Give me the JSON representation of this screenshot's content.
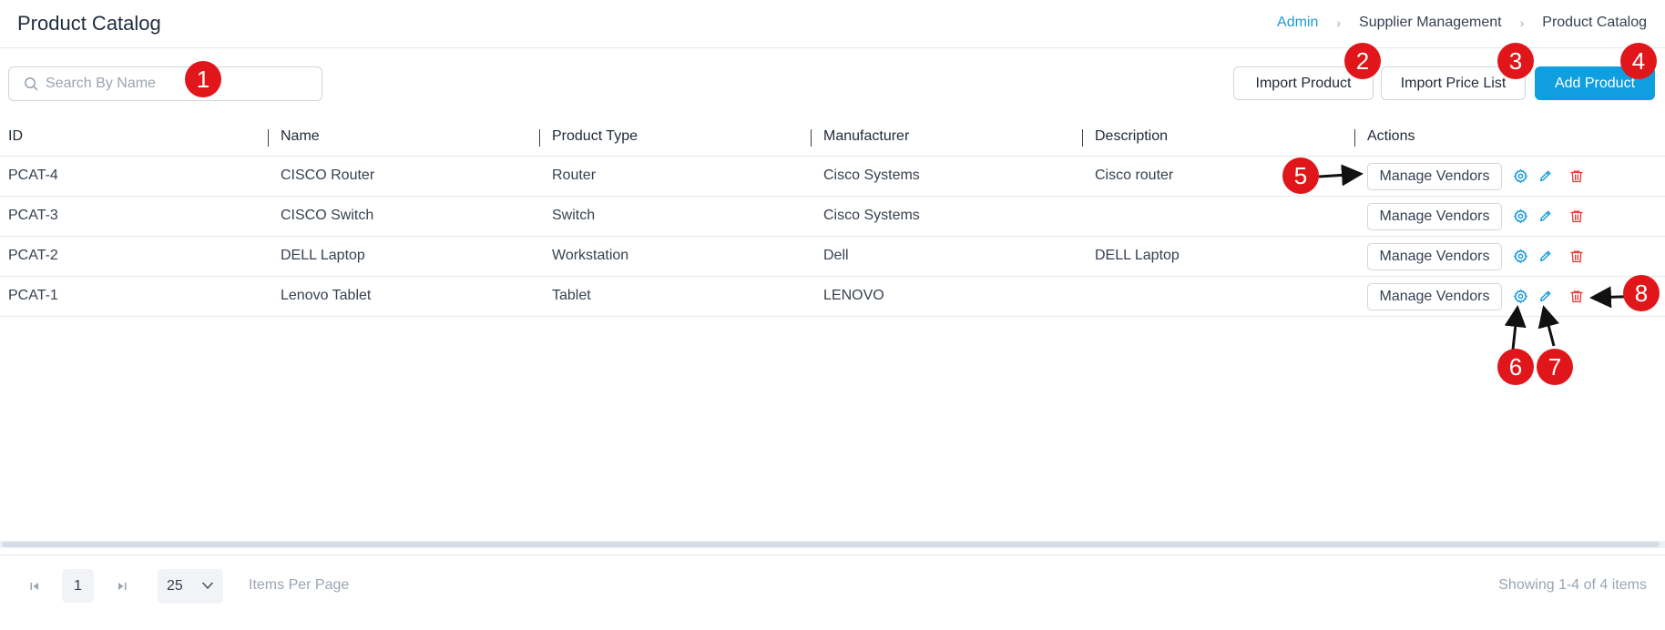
{
  "header": {
    "title": "Product Catalog",
    "breadcrumb": [
      "Admin",
      "Supplier Management",
      "Product Catalog"
    ]
  },
  "toolbar": {
    "search_placeholder": "Search By Name",
    "import_product_label": "Import Product",
    "import_price_list_label": "Import Price List",
    "add_product_label": "Add Product"
  },
  "table": {
    "columns": [
      "ID",
      "Name",
      "Product Type",
      "Manufacturer",
      "Description",
      "Actions"
    ],
    "rows": [
      {
        "id": "PCAT-4",
        "name": "CISCO Router",
        "type": "Router",
        "manufacturer": "Cisco Systems",
        "description": "Cisco router",
        "action_label": "Manage Vendors"
      },
      {
        "id": "PCAT-3",
        "name": "CISCO Switch",
        "type": "Switch",
        "manufacturer": "Cisco Systems",
        "description": "",
        "action_label": "Manage Vendors"
      },
      {
        "id": "PCAT-2",
        "name": "DELL Laptop",
        "type": "Workstation",
        "manufacturer": "Dell",
        "description": "DELL Laptop",
        "action_label": "Manage Vendors"
      },
      {
        "id": "PCAT-1",
        "name": "Lenovo Tablet",
        "type": "Tablet",
        "manufacturer": "LENOVO",
        "description": "",
        "action_label": "Manage Vendors"
      }
    ]
  },
  "pagination": {
    "current_page": "1",
    "per_page": "25",
    "per_page_label": "Items Per Page",
    "showing_text": "Showing 1-4 of 4 items"
  },
  "callouts": [
    "1",
    "2",
    "3",
    "4",
    "5",
    "6",
    "7",
    "8"
  ],
  "colors": {
    "accent": "#0f9ee0",
    "breadcrumb_link": "#1a9bd7",
    "gear_icon": "#1a9bd7",
    "edit_icon": "#1a9bd7",
    "delete_icon": "#e53935",
    "callout": "#e0161b"
  },
  "icons": {
    "search": "search-icon",
    "settings": "gear-icon",
    "edit": "pencil-icon",
    "delete": "trash-icon",
    "first_page": "first-page-icon",
    "last_page": "last-page-icon",
    "dropdown": "chevron-down-icon"
  }
}
